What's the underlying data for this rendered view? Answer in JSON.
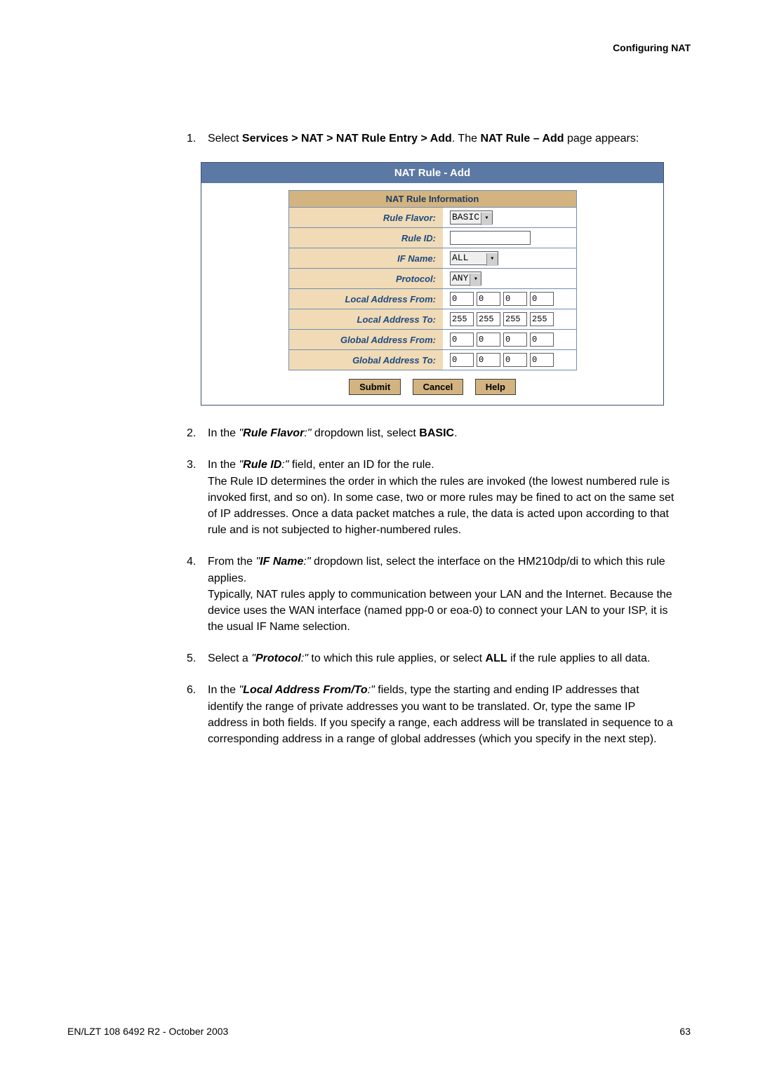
{
  "header": {
    "right": "Configuring NAT"
  },
  "steps": {
    "s1": {
      "num": "1.",
      "pre": "Select ",
      "nav": "Services > NAT > NAT Rule Entry > Add",
      "mid": ". The ",
      "nav2": "NAT Rule – Add",
      "post": " page appears:"
    },
    "s2": {
      "num": "2.",
      "pre": "In the ",
      "q1": "\"",
      "field": "Rule Flavor",
      "q2": ":\"",
      "mid": " dropdown list, select ",
      "sel": "BASIC",
      "post": "."
    },
    "s3": {
      "num": "3.",
      "pre": "In the ",
      "q1": "\"",
      "field": "Rule ID",
      "q2": ":\"",
      "mid": " field, enter an ID for the rule.",
      "body": "The Rule ID determines the order in which the rules are invoked (the lowest numbered rule is invoked first, and so on). In some case, two or more rules may be fined to act on the same set of IP addresses. Once a data packet matches a rule, the data is acted upon according to that rule and is not subjected to higher-numbered rules."
    },
    "s4": {
      "num": "4.",
      "pre": "From the ",
      "q1": "\"",
      "field": "IF Name",
      "q2": ":\"",
      "mid": " dropdown list, select the interface on the HM210dp/di to which this rule applies.",
      "body": "Typically, NAT rules apply to communication between your LAN and the Internet. Because the device uses the WAN interface (named ppp-0 or eoa-0) to connect your LAN to your ISP, it is the usual IF Name selection."
    },
    "s5": {
      "num": "5.",
      "pre": "Select a ",
      "q1": "\"",
      "field": "Protocol",
      "q2": ":\"",
      "mid": " to which this rule applies, or select ",
      "sel": "ALL",
      "post": " if the rule applies to all data."
    },
    "s6": {
      "num": "6.",
      "pre": "In the ",
      "q1": "\"",
      "field": "Local Address From/To",
      "q2": ":\"",
      "mid": " fields, type the starting and ending IP addresses that identify the range of private addresses you want to be translated. Or, type the same IP address in both fields. If you specify a range, each address will be translated in sequence to a corresponding address in a range of global addresses (which you specify in the next step)."
    }
  },
  "form": {
    "title": "NAT Rule - Add",
    "section": "NAT Rule Information",
    "rows": {
      "flavor_label": "Rule Flavor:",
      "flavor_value": "BASIC",
      "id_label": "Rule ID:",
      "ifname_label": "IF Name:",
      "ifname_value": "ALL",
      "protocol_label": "Protocol:",
      "protocol_value": "ANY",
      "laf_label": "Local Address From:",
      "lat_label": "Local Address To:",
      "gaf_label": "Global Address From:",
      "gat_label": "Global Address To:"
    },
    "ip": {
      "laf": [
        "0",
        "0",
        "0",
        "0"
      ],
      "lat": [
        "255",
        "255",
        "255",
        "255"
      ],
      "gaf": [
        "0",
        "0",
        "0",
        "0"
      ],
      "gat": [
        "0",
        "0",
        "0",
        "0"
      ]
    },
    "buttons": {
      "submit": "Submit",
      "cancel": "Cancel",
      "help": "Help"
    }
  },
  "footer": {
    "left": "EN/LZT 108 6492 R2 - October 2003",
    "right": "63"
  }
}
